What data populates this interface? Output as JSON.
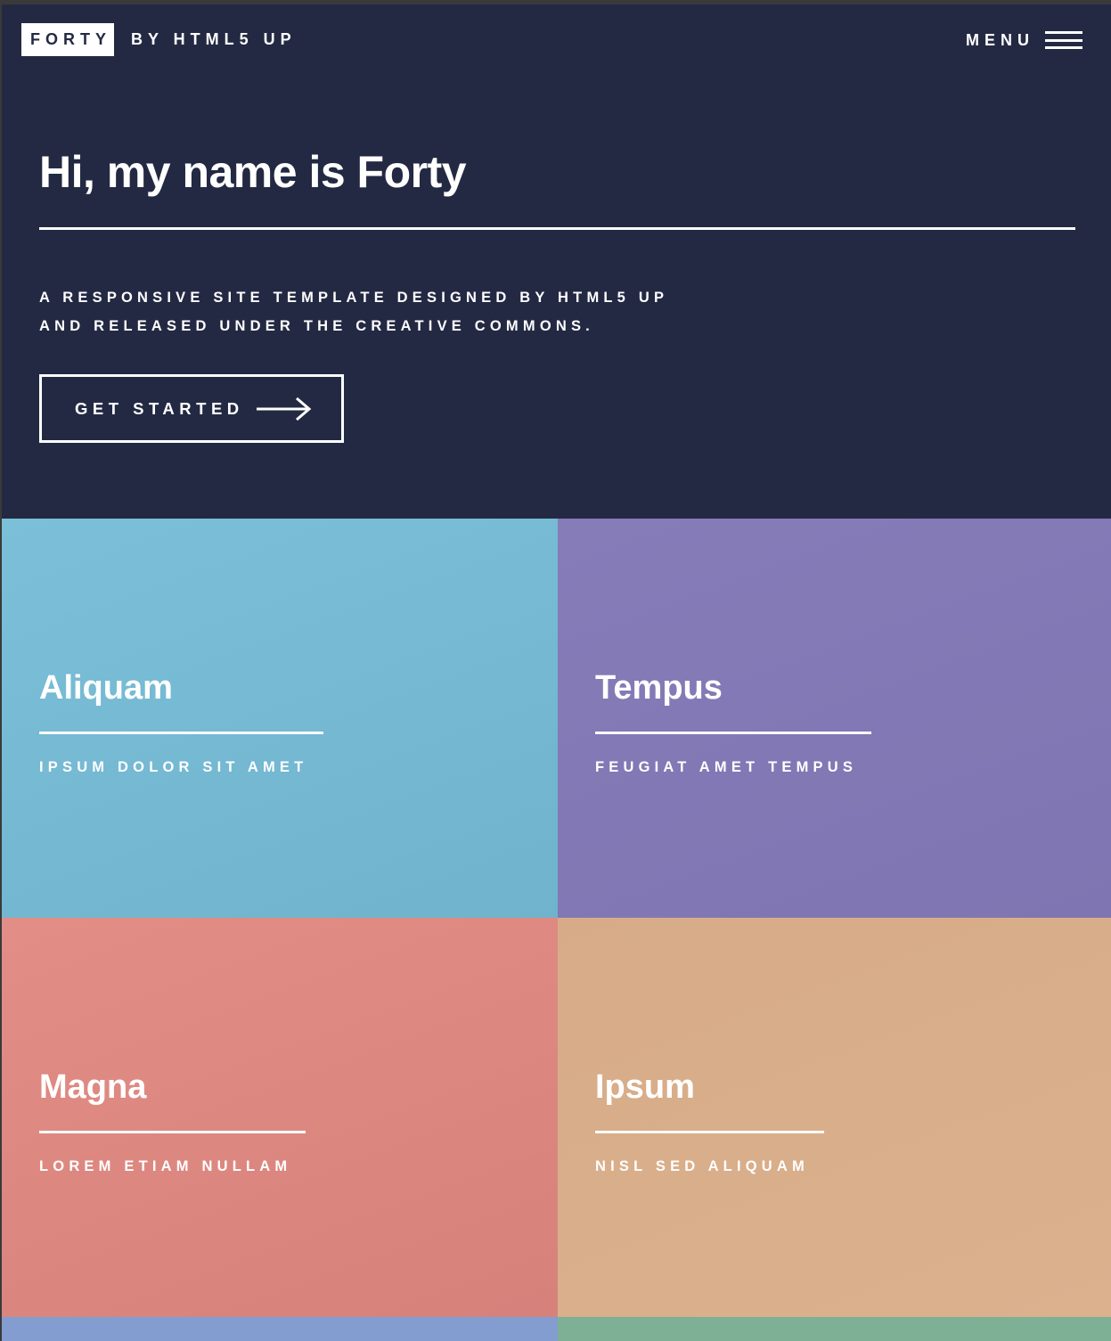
{
  "header": {
    "logo_name": "FORTY",
    "logo_by": "BY HTML5 UP",
    "menu_label": "MENU"
  },
  "banner": {
    "title": "Hi, my name is Forty",
    "tagline_line1": "A RESPONSIVE SITE TEMPLATE DESIGNED BY HTML5 UP",
    "tagline_line2": "AND RELEASED UNDER THE CREATIVE COMMONS.",
    "cta_label": "GET STARTED"
  },
  "tiles": [
    {
      "title": "Aliquam",
      "subtitle": "IPSUM DOLOR SIT AMET",
      "color": "#76badb"
    },
    {
      "title": "Tempus",
      "subtitle": "FEUGIAT AMET TEMPUS",
      "color": "#8279b5"
    },
    {
      "title": "Magna",
      "subtitle": "LOREM ETIAM NULLAM",
      "color": "#dd8881"
    },
    {
      "title": "Ipsum",
      "subtitle": "NISL SED ALIQUAM",
      "color": "#d8ae8a"
    }
  ],
  "colors": {
    "background": "#242943",
    "accent_text": "#ffffff",
    "tile_row3_left": "#849dd0",
    "tile_row3_right": "#7eb095"
  }
}
